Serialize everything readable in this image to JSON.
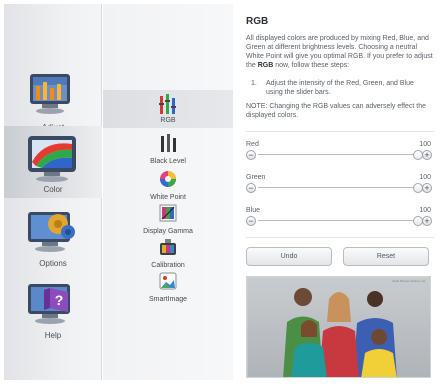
{
  "sidebar": {
    "categories": [
      {
        "label": "Adjust",
        "icon": "adjust-icon"
      },
      {
        "label": "Color",
        "icon": "color-icon"
      },
      {
        "label": "Options",
        "icon": "options-icon"
      },
      {
        "label": "Help",
        "icon": "help-icon"
      }
    ],
    "active_index": 1
  },
  "submenu": {
    "items": [
      {
        "label": "RGB",
        "icon": "rgb-bars-icon"
      },
      {
        "label": "Black Level",
        "icon": "black-level-icon"
      },
      {
        "label": "White Point",
        "icon": "white-point-icon"
      },
      {
        "label": "Display Gamma",
        "icon": "display-gamma-icon"
      },
      {
        "label": "Calibration",
        "icon": "calibration-icon"
      },
      {
        "label": "SmartImage",
        "icon": "smartimage-icon"
      }
    ],
    "active_index": 0
  },
  "content": {
    "title": "RGB",
    "desc_1": "All displayed colors are produced by mixing Red, Blue, and Green at different brightness levels. Choosing a neutral White Point will give you optimal RGB. If you prefer to adjust the ",
    "desc_bold": "RGB",
    "desc_2": " now, follow these steps:",
    "step_number": "1.",
    "step_text": "Adjust the intensity of the Red, Green, and Blue using the slider bars.",
    "note": "NOTE: Changing the RGB values can adversely effect the displayed colors.",
    "sliders": [
      {
        "label": "Red",
        "value": "100",
        "level": 1.0
      },
      {
        "label": "Green",
        "value": "100",
        "level": 1.0
      },
      {
        "label": "Blue",
        "value": "100",
        "level": 1.0
      }
    ],
    "undo_label": "Undo",
    "reset_label": "Reset",
    "photo_caption": "Solid Picture Testing, Inc."
  }
}
